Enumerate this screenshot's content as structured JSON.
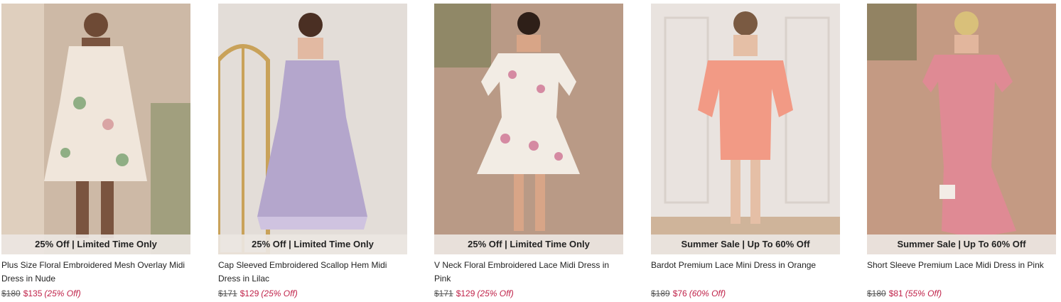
{
  "products": [
    {
      "banner": "25% Off | Limited Time Only",
      "title": "Plus Size Floral Embroidered Mesh Overlay Midi Dress in Nude",
      "was_price": "$180",
      "now_price": "$135",
      "discount": "(25% Off)",
      "colors": {
        "bg": "#cdb9a6",
        "dress": "#f1e8dd",
        "accent": "#8fae84"
      }
    },
    {
      "banner": "25% Off | Limited Time Only",
      "title": "Cap Sleeved Embroidered Scallop Hem Midi Dress in Lilac",
      "was_price": "$171",
      "now_price": "$129",
      "discount": "(25% Off)",
      "colors": {
        "bg": "#e3ddd8",
        "dress": "#b4a6cc",
        "accent": "#cfc3e0"
      }
    },
    {
      "banner": "25% Off | Limited Time Only",
      "title": "V Neck Floral Embroidered Lace Midi Dress in Pink",
      "was_price": "$171",
      "now_price": "$129",
      "discount": "(25% Off)",
      "colors": {
        "bg": "#b99a86",
        "dress": "#f2ece4",
        "accent": "#d58aa2"
      }
    },
    {
      "banner": "Summer Sale | Up To 60% Off",
      "title": "Bardot Premium Lace Mini Dress in Orange",
      "was_price": "$189",
      "now_price": "$76",
      "discount": "(60% Off)",
      "colors": {
        "bg": "#e9e3df",
        "dress": "#f29a85",
        "accent": "#f7b8a6"
      }
    },
    {
      "banner": "Summer Sale | Up To 60% Off",
      "title": "Short Sleeve Premium Lace Midi Dress in Pink",
      "was_price": "$180",
      "now_price": "$81",
      "discount": "(55% Off)",
      "colors": {
        "bg": "#c49a83",
        "dress": "#df8a94",
        "accent": "#eaa5ad"
      }
    }
  ]
}
